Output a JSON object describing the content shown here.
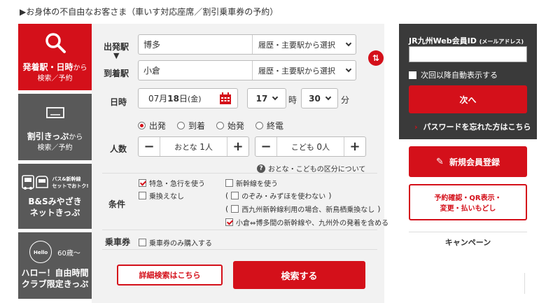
{
  "notice": "▶お身体の不自由なお客さま（車いす対応座席／割引乗車券の予約）",
  "tabs": [
    {
      "line1_a": "発着駅・日時",
      "line1_b": "から",
      "line2": "検索／予約"
    },
    {
      "line1_a": "割引きっぷ",
      "line1_b": "から",
      "line2": "検索／予約"
    },
    {
      "badge1": "バス&新幹線",
      "badge2": "セットでおトク!",
      "line1": "B&Sみやざき",
      "line2": "ネットきっぷ"
    },
    {
      "age": "60歳〜",
      "line1": "ハロー！自由時間",
      "line2": "クラブ限定きっぷ"
    }
  ],
  "search": {
    "departure_label": "出発駅",
    "departure_value": "博多",
    "arrival_label": "到着駅",
    "arrival_value": "小倉",
    "station_select": "履歴・主要駅から選択",
    "datetime_label": "日時",
    "date_month": "07",
    "date_month_unit": "月",
    "date_day": "18",
    "date_day_unit": "日",
    "date_weekday": "(金)",
    "hour": "17",
    "hour_unit": "時",
    "minute": "30",
    "minute_unit": "分",
    "time_types": [
      "出発",
      "到着",
      "始発",
      "終電"
    ],
    "people_label": "人数",
    "adult_label": "おとな",
    "adult_count": "1",
    "child_label": "こども",
    "child_count": "0",
    "person_unit": "人",
    "age_help": "おとな・こどもの区分について",
    "conditions_label": "条件",
    "cond_express": "特急・急行を使う",
    "cond_shinkansen": "新幹線を使う",
    "cond_no_transfer": "乗換えなし",
    "cond_nozomi": "のぞみ・みずほを使わない",
    "cond_nishikyushu": "西九州新幹線利用の場合、新鳥栖乗換なし",
    "cond_kokura": "小倉⇔博多間の新幹線や、九州外の発着を含める",
    "ticket_label": "乗車券",
    "ticket_only": "乗車券のみ購入する",
    "detail_button": "詳細検索はこちら",
    "search_button": "検索する"
  },
  "login": {
    "title": "JR九州Web会員ID",
    "title_small": "(メールアドレス)",
    "auto_show": "次回以降自動表示する",
    "next_button": "次へ",
    "forgot_password": "パスワードを忘れた方はこちら"
  },
  "side": {
    "register_button": "新規会員登録",
    "reserve_line1": "予約確認・QR表示・",
    "reserve_line2": "変更・払いもどし",
    "campaign": "キャンペーン"
  },
  "colors": {
    "accent": "#d4101a",
    "tab_gray": "#595959",
    "panel": "#f2f2f2",
    "login_bg": "#3a3a3a"
  }
}
